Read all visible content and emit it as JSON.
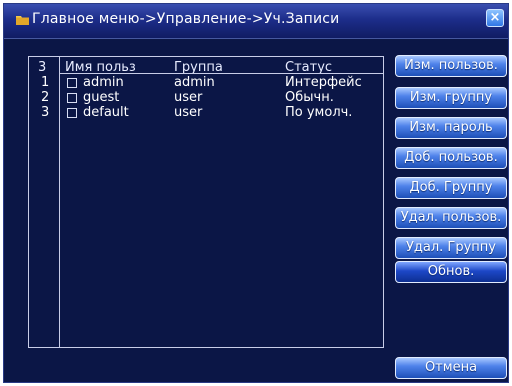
{
  "window": {
    "title": "Главное меню->Управление->Уч.Записи",
    "close_label": "×"
  },
  "table": {
    "count": "3",
    "columns": [
      "Имя польз",
      "Группа",
      "Статус"
    ],
    "rows": [
      {
        "index": "1",
        "name": "admin",
        "group": "admin",
        "status": "Интерфейс",
        "checked": false
      },
      {
        "index": "2",
        "name": "guest",
        "group": "user",
        "status": "Обычн.",
        "checked": false
      },
      {
        "index": "3",
        "name": "default",
        "group": "user",
        "status": "По умолч.",
        "checked": false
      }
    ]
  },
  "buttons": {
    "edit_user": "Изм. пользов.",
    "edit_group": "Изм. группу",
    "edit_password": "Изм. пароль",
    "add_user": "Доб. пользов.",
    "add_group": "Доб. Группу",
    "delete_user": "Удал. пользов.",
    "delete_group": "Удал. Группу",
    "refresh": "Обнов.",
    "cancel": "Отмена"
  },
  "colors": {
    "background": "#0b1646",
    "titlebar": "#1d2d8a",
    "button": "#4f83ea"
  }
}
